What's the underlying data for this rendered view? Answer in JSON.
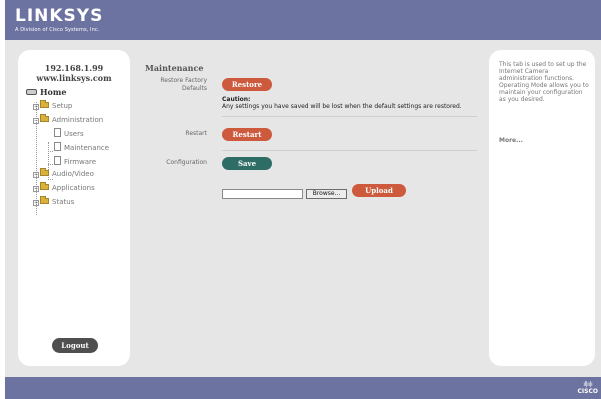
{
  "header": {
    "brand": "LINKSYS",
    "brand_sub": "A Division of Cisco Systems, Inc."
  },
  "footer": {
    "vendor_bars": "ıl|ıı|ı",
    "vendor_name": "CISCO"
  },
  "nav": {
    "ip": "192.168.1.99",
    "host": "www.linksys.com",
    "home": "Home",
    "setup": "Setup",
    "administration": "Administration",
    "users": "Users",
    "maintenance": "Maintenance",
    "firmware": "Firmware",
    "audio_video": "Audio/Video",
    "applications": "Applications",
    "status": "Status",
    "logout": "Logout",
    "expand_symbol": "+",
    "collapse_symbol": "−"
  },
  "content": {
    "section_title": "Maintenance",
    "restore_label_line1": "Restore Factory",
    "restore_label_line2": "Defaults",
    "restore_button": "Restore",
    "caution_title": "Caution:",
    "caution_text": "Any settings you have saved will be lost when the default settings are restored.",
    "restart_label": "Restart",
    "restart_button": "Restart",
    "configuration_label": "Configuration",
    "save_button": "Save",
    "file_value": "",
    "browse_button": "Browse...",
    "upload_button": "Upload"
  },
  "help": {
    "text": "This tab is used to set up the Internet Camera administration functions. Operating Mode allows you to maintain your configuration as you desired.",
    "more": "More..."
  },
  "colors": {
    "header_blue": "#6c73a0",
    "accent_red": "#cd5a3c",
    "accent_teal": "#2e6d66",
    "panel_gray": "#e6e6e6"
  },
  "icons": {
    "home": "home-icon",
    "folder": "folder-icon",
    "page": "page-icon",
    "expander": "expand-icon"
  }
}
